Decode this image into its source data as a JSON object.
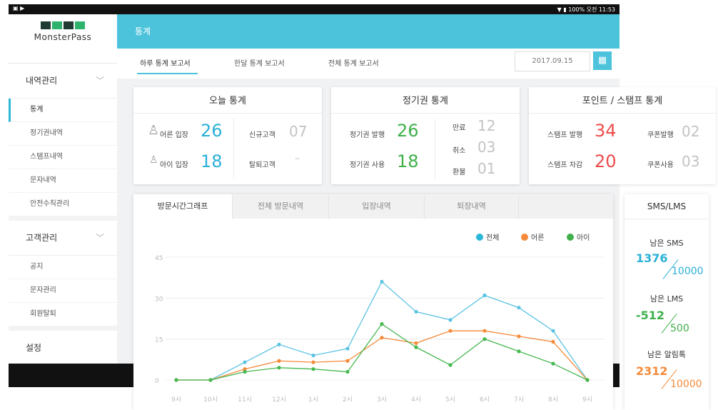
{
  "status_bar": {
    "left_icons": "▣ ▶",
    "right_text": "▼ ▮ 100% 오전 11:53"
  },
  "logo": {
    "name": "MonsterPass"
  },
  "sidebar": {
    "groups": [
      {
        "label": "내역관리",
        "items": [
          "통계",
          "정기권내역",
          "스탬프내역",
          "문자내역",
          "안전수칙관리"
        ]
      },
      {
        "label": "고객관리",
        "items": [
          "공지",
          "문자관리",
          "회원탈퇴"
        ]
      },
      {
        "label": "설정"
      }
    ],
    "chevron": "﹀"
  },
  "header": {
    "title": "통계"
  },
  "report_tabs": [
    "하루 통계 보고서",
    "한달 통계 보고서",
    "전체 통계 보고서"
  ],
  "date": {
    "value": "2017.09.15"
  },
  "cards": {
    "today": {
      "title": "오늘 통계",
      "adult_label": "어른 입장",
      "adult_value": "26",
      "child_label": "아이 입장",
      "child_value": "18",
      "new_label": "신규고객",
      "new_value": "07",
      "quit_label": "탈퇴고객",
      "quit_value": "–"
    },
    "season": {
      "title": "정기권 통계",
      "issue_label": "정기권 발행",
      "issue_value": "26",
      "use_label": "정기권 사용",
      "use_value": "18",
      "expire_label": "만료",
      "expire_value": "12",
      "cancel_label": "취소",
      "cancel_value": "03",
      "refund_label": "환불",
      "refund_value": "01"
    },
    "stamp": {
      "title": "포인트 / 스탬프 통계",
      "issue_label": "스탬프 발행",
      "issue_value": "34",
      "deduct_label": "스탬프 차감",
      "deduct_value": "20",
      "coupon_issue_label": "쿠폰발행",
      "coupon_issue_value": "02",
      "coupon_use_label": "쿠폰사용",
      "coupon_use_value": "03"
    }
  },
  "chart_tabs": [
    "방문시간그래프",
    "전체 방문내역",
    "입장내역",
    "퇴장내역"
  ],
  "sms": {
    "title": "SMS/LMS",
    "sms_label": "남은 SMS",
    "sms_value": "1376",
    "sms_total": "10000",
    "lms_label": "남은 LMS",
    "lms_value": "-512",
    "lms_total": "500",
    "talk_label": "남은 알림톡",
    "talk_value": "2312",
    "talk_total": "10000"
  },
  "colors": {
    "accent": "#4cc3db",
    "total": "#5bc3e3",
    "adult": "#f58a3a",
    "child": "#45b84f"
  },
  "chart_data": {
    "type": "line",
    "categories": [
      "9시",
      "10시",
      "11시",
      "12시",
      "1시",
      "2시",
      "3시",
      "4시",
      "5시",
      "6시",
      "7시",
      "8시",
      "9시"
    ],
    "y_ticks": [
      "45",
      "30",
      "15",
      "0"
    ],
    "ylim": [
      0,
      45
    ],
    "legend_position": "top-right",
    "series": [
      {
        "name": "전체",
        "color": "#5bc3e3",
        "values": [
          0,
          0,
          6.5,
          13,
          9,
          11.5,
          36,
          25,
          22,
          31,
          26.5,
          18,
          0
        ]
      },
      {
        "name": "어른",
        "color": "#f58a3a",
        "values": [
          0,
          0,
          4,
          7,
          6.5,
          7,
          15.5,
          13.5,
          18,
          18,
          16,
          14,
          0
        ]
      },
      {
        "name": "아이",
        "color": "#45b84f",
        "values": [
          0,
          0,
          3,
          4.5,
          4,
          3,
          20.5,
          12,
          5.5,
          15,
          10.5,
          6,
          0
        ]
      }
    ]
  }
}
